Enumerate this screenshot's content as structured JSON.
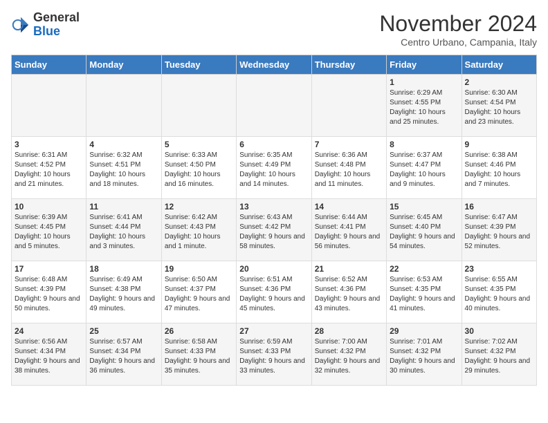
{
  "logo": {
    "general": "General",
    "blue": "Blue"
  },
  "header": {
    "month": "November 2024",
    "location": "Centro Urbano, Campania, Italy"
  },
  "days_header": [
    "Sunday",
    "Monday",
    "Tuesday",
    "Wednesday",
    "Thursday",
    "Friday",
    "Saturday"
  ],
  "weeks": [
    [
      {
        "day": "",
        "info": ""
      },
      {
        "day": "",
        "info": ""
      },
      {
        "day": "",
        "info": ""
      },
      {
        "day": "",
        "info": ""
      },
      {
        "day": "",
        "info": ""
      },
      {
        "day": "1",
        "info": "Sunrise: 6:29 AM\nSunset: 4:55 PM\nDaylight: 10 hours and 25 minutes."
      },
      {
        "day": "2",
        "info": "Sunrise: 6:30 AM\nSunset: 4:54 PM\nDaylight: 10 hours and 23 minutes."
      }
    ],
    [
      {
        "day": "3",
        "info": "Sunrise: 6:31 AM\nSunset: 4:52 PM\nDaylight: 10 hours and 21 minutes."
      },
      {
        "day": "4",
        "info": "Sunrise: 6:32 AM\nSunset: 4:51 PM\nDaylight: 10 hours and 18 minutes."
      },
      {
        "day": "5",
        "info": "Sunrise: 6:33 AM\nSunset: 4:50 PM\nDaylight: 10 hours and 16 minutes."
      },
      {
        "day": "6",
        "info": "Sunrise: 6:35 AM\nSunset: 4:49 PM\nDaylight: 10 hours and 14 minutes."
      },
      {
        "day": "7",
        "info": "Sunrise: 6:36 AM\nSunset: 4:48 PM\nDaylight: 10 hours and 11 minutes."
      },
      {
        "day": "8",
        "info": "Sunrise: 6:37 AM\nSunset: 4:47 PM\nDaylight: 10 hours and 9 minutes."
      },
      {
        "day": "9",
        "info": "Sunrise: 6:38 AM\nSunset: 4:46 PM\nDaylight: 10 hours and 7 minutes."
      }
    ],
    [
      {
        "day": "10",
        "info": "Sunrise: 6:39 AM\nSunset: 4:45 PM\nDaylight: 10 hours and 5 minutes."
      },
      {
        "day": "11",
        "info": "Sunrise: 6:41 AM\nSunset: 4:44 PM\nDaylight: 10 hours and 3 minutes."
      },
      {
        "day": "12",
        "info": "Sunrise: 6:42 AM\nSunset: 4:43 PM\nDaylight: 10 hours and 1 minute."
      },
      {
        "day": "13",
        "info": "Sunrise: 6:43 AM\nSunset: 4:42 PM\nDaylight: 9 hours and 58 minutes."
      },
      {
        "day": "14",
        "info": "Sunrise: 6:44 AM\nSunset: 4:41 PM\nDaylight: 9 hours and 56 minutes."
      },
      {
        "day": "15",
        "info": "Sunrise: 6:45 AM\nSunset: 4:40 PM\nDaylight: 9 hours and 54 minutes."
      },
      {
        "day": "16",
        "info": "Sunrise: 6:47 AM\nSunset: 4:39 PM\nDaylight: 9 hours and 52 minutes."
      }
    ],
    [
      {
        "day": "17",
        "info": "Sunrise: 6:48 AM\nSunset: 4:39 PM\nDaylight: 9 hours and 50 minutes."
      },
      {
        "day": "18",
        "info": "Sunrise: 6:49 AM\nSunset: 4:38 PM\nDaylight: 9 hours and 49 minutes."
      },
      {
        "day": "19",
        "info": "Sunrise: 6:50 AM\nSunset: 4:37 PM\nDaylight: 9 hours and 47 minutes."
      },
      {
        "day": "20",
        "info": "Sunrise: 6:51 AM\nSunset: 4:36 PM\nDaylight: 9 hours and 45 minutes."
      },
      {
        "day": "21",
        "info": "Sunrise: 6:52 AM\nSunset: 4:36 PM\nDaylight: 9 hours and 43 minutes."
      },
      {
        "day": "22",
        "info": "Sunrise: 6:53 AM\nSunset: 4:35 PM\nDaylight: 9 hours and 41 minutes."
      },
      {
        "day": "23",
        "info": "Sunrise: 6:55 AM\nSunset: 4:35 PM\nDaylight: 9 hours and 40 minutes."
      }
    ],
    [
      {
        "day": "24",
        "info": "Sunrise: 6:56 AM\nSunset: 4:34 PM\nDaylight: 9 hours and 38 minutes."
      },
      {
        "day": "25",
        "info": "Sunrise: 6:57 AM\nSunset: 4:34 PM\nDaylight: 9 hours and 36 minutes."
      },
      {
        "day": "26",
        "info": "Sunrise: 6:58 AM\nSunset: 4:33 PM\nDaylight: 9 hours and 35 minutes."
      },
      {
        "day": "27",
        "info": "Sunrise: 6:59 AM\nSunset: 4:33 PM\nDaylight: 9 hours and 33 minutes."
      },
      {
        "day": "28",
        "info": "Sunrise: 7:00 AM\nSunset: 4:32 PM\nDaylight: 9 hours and 32 minutes."
      },
      {
        "day": "29",
        "info": "Sunrise: 7:01 AM\nSunset: 4:32 PM\nDaylight: 9 hours and 30 minutes."
      },
      {
        "day": "30",
        "info": "Sunrise: 7:02 AM\nSunset: 4:32 PM\nDaylight: 9 hours and 29 minutes."
      }
    ]
  ]
}
